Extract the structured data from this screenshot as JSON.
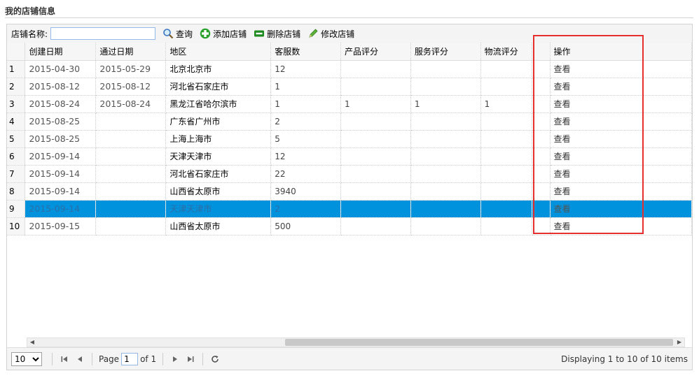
{
  "page_title": "我的店铺信息",
  "toolbar": {
    "name_label": "店铺名称:",
    "name_value": "",
    "query_label": "查询",
    "add_label": "添加店铺",
    "delete_label": "删除店铺",
    "edit_label": "修改店铺"
  },
  "columns": [
    "创建日期",
    "通过日期",
    "地区",
    "客服数",
    "产品评分",
    "服务评分",
    "物流评分",
    "",
    "操作"
  ],
  "rows": [
    {
      "n": "1",
      "created": "2015-04-30",
      "passed": "2015-05-29",
      "region": "北京北京市",
      "cs": "12",
      "p": "",
      "s": "",
      "l": "",
      "op": "查看"
    },
    {
      "n": "2",
      "created": "2015-08-12",
      "passed": "2015-08-12",
      "region": "河北省石家庄市",
      "cs": "1",
      "p": "",
      "s": "",
      "l": "",
      "op": "查看"
    },
    {
      "n": "3",
      "created": "2015-08-24",
      "passed": "2015-08-24",
      "region": "黑龙江省哈尔滨市",
      "cs": "1",
      "p": "1",
      "s": "1",
      "l": "1",
      "op": "查看"
    },
    {
      "n": "4",
      "created": "2015-08-25",
      "passed": "",
      "region": "广东省广州市",
      "cs": "2",
      "p": "",
      "s": "",
      "l": "",
      "op": "查看"
    },
    {
      "n": "5",
      "created": "2015-08-25",
      "passed": "",
      "region": "上海上海市",
      "cs": "5",
      "p": "",
      "s": "",
      "l": "",
      "op": "查看"
    },
    {
      "n": "6",
      "created": "2015-09-14",
      "passed": "",
      "region": "天津天津市",
      "cs": "12",
      "p": "",
      "s": "",
      "l": "",
      "op": "查看"
    },
    {
      "n": "7",
      "created": "2015-09-14",
      "passed": "",
      "region": "河北省石家庄市",
      "cs": "22",
      "p": "",
      "s": "",
      "l": "",
      "op": "查看"
    },
    {
      "n": "8",
      "created": "2015-09-14",
      "passed": "",
      "region": "山西省太原市",
      "cs": "3940",
      "p": "",
      "s": "",
      "l": "",
      "op": "查看"
    },
    {
      "n": "9",
      "created": "2015-09-14",
      "passed": "",
      "region": "天津天津市",
      "cs": "2",
      "p": "",
      "s": "",
      "l": "",
      "op": "查看",
      "selected": true
    },
    {
      "n": "10",
      "created": "2015-09-15",
      "passed": "",
      "region": "山西省太原市",
      "cs": "500",
      "p": "",
      "s": "",
      "l": "",
      "op": "查看"
    }
  ],
  "pager": {
    "page_size": "10",
    "page_label": "Page",
    "page_value": "1",
    "of_label": "of 1",
    "info": "Displaying 1 to 10 of 10 items"
  },
  "colors": {
    "selected_row": "#0092dc",
    "highlight_box": "#e63030",
    "add_icon": "#2aa02a",
    "delete_icon": "#1f8a1f"
  },
  "icons": [
    "search-icon",
    "add-icon",
    "delete-icon",
    "edit-icon",
    "first-page-icon",
    "prev-page-icon",
    "next-page-icon",
    "last-page-icon",
    "refresh-icon"
  ]
}
